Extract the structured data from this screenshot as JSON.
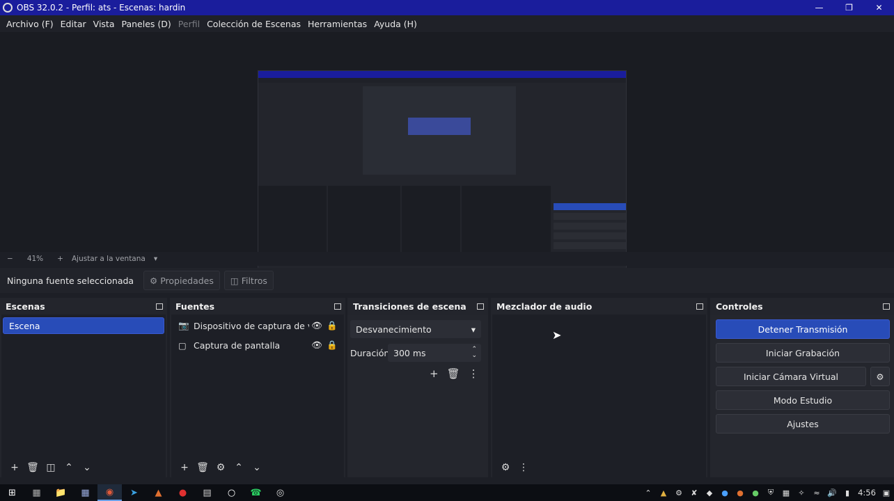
{
  "window": {
    "title": "OBS 32.0.2 - Perfil: ats - Escenas: hardin"
  },
  "menu": {
    "items": [
      "Archivo (F)",
      "Editar",
      "Vista",
      "Paneles (D)",
      "Perfil",
      "Colección de Escenas",
      "Herramientas",
      "Ayuda (H)"
    ]
  },
  "zoom": {
    "level": "41%",
    "fit_label": "Ajustar a la ventana"
  },
  "source_toolbar": {
    "no_selection": "Ninguna fuente seleccionada",
    "properties": "Propiedades",
    "filters": "Filtros"
  },
  "scenes": {
    "title": "Escenas",
    "items": [
      "Escena"
    ]
  },
  "sources": {
    "title": "Fuentes",
    "items": [
      "Dispositivo de captura de vídeo",
      "Captura de pantalla"
    ]
  },
  "transitions": {
    "title": "Transiciones de escena",
    "selected": "Desvanecimiento",
    "duration_label": "Duración",
    "duration_value": "300 ms"
  },
  "mixer": {
    "title": "Mezclador de audio"
  },
  "controls": {
    "title": "Controles",
    "stop_stream": "Detener Transmisión",
    "start_recording": "Iniciar Grabación",
    "start_virtualcam": "Iniciar Cámara Virtual",
    "studio_mode": "Modo Estudio",
    "settings": "Ajustes"
  },
  "taskbar": {
    "clock": "4:56"
  },
  "colors": {
    "accent": "#284cb8",
    "titlebar": "#1a1d9c"
  }
}
